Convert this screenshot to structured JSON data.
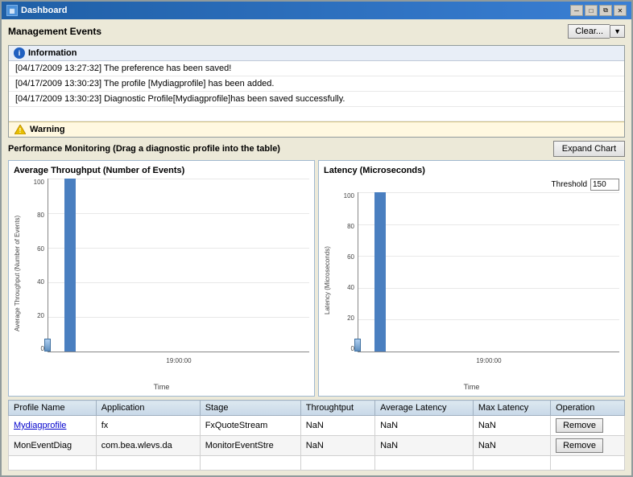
{
  "window": {
    "title": "Dashboard",
    "controls": {
      "minimize": "─",
      "restore": "□",
      "maximize": "⧉",
      "close": "✕"
    }
  },
  "management_events": {
    "label": "Management Events",
    "clear_button": "Clear...",
    "info_label": "Information",
    "events": [
      "[04/17/2009 13:27:32] The preference has been saved!",
      "[04/17/2009 13:30:23] The profile [Mydiagprofile] has been added.",
      "[04/17/2009 13:30:23] Diagnostic Profile[Mydiagprofile]has been saved successfully."
    ],
    "warning_label": "Warning"
  },
  "performance": {
    "label": "Performance Monitoring (Drag a diagnostic profile into the table)",
    "expand_button": "Expand Chart",
    "chart1": {
      "title": "Average Throughput (Number of Events)",
      "y_label": "Average Throughput (Number of Events)",
      "x_label": "Time",
      "time_label": "19:00:00",
      "y_ticks": [
        "100",
        "80",
        "60",
        "40",
        "20",
        "0"
      ],
      "bar_height_pct": 100
    },
    "chart2": {
      "title": "Latency (Microseconds)",
      "y_label": "Latency (Microseconds)",
      "x_label": "Time",
      "time_label": "19:00:00",
      "y_ticks": [
        "100",
        "80",
        "60",
        "40",
        "20",
        "0"
      ],
      "bar_height_pct": 100,
      "threshold_label": "Threshold",
      "threshold_value": "150"
    }
  },
  "table": {
    "headers": [
      "Profile Name",
      "Application",
      "Stage",
      "Throughtput",
      "Average Latency",
      "Max Latency",
      "Operation"
    ],
    "rows": [
      {
        "profile": "Mydiagprofile",
        "application": "fx",
        "stage": "FxQuoteStream",
        "throughput": "NaN",
        "avg_latency": "NaN",
        "max_latency": "NaN",
        "action": "Remove"
      },
      {
        "profile": "MonEventDiag",
        "application": "com.bea.wlevs.da",
        "stage": "MonitorEventStre",
        "throughput": "NaN",
        "avg_latency": "NaN",
        "max_latency": "NaN",
        "action": "Remove"
      }
    ]
  }
}
